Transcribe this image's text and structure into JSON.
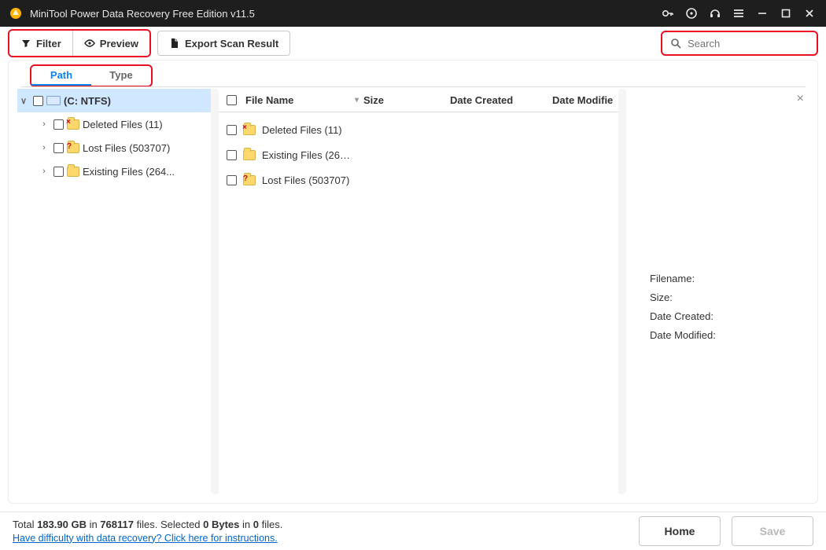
{
  "titlebar": {
    "title": "MiniTool Power Data Recovery Free Edition v11.5"
  },
  "toolbar": {
    "filter_label": "Filter",
    "preview_label": "Preview",
    "export_label": "Export Scan Result",
    "search_placeholder": "Search"
  },
  "tabs": {
    "path": "Path",
    "type": "Type"
  },
  "tree": {
    "root_label": "(C: NTFS)",
    "children": [
      {
        "label": "Deleted Files (11)",
        "icon": "redx"
      },
      {
        "label": "Lost Files (503707)",
        "icon": "q"
      },
      {
        "label": "Existing Files (264...",
        "icon": ""
      }
    ]
  },
  "list": {
    "headers": {
      "name": "File Name",
      "size": "Size",
      "created": "Date Created",
      "modified": "Date Modifie"
    },
    "rows": [
      {
        "name": "Deleted Files (11)",
        "icon": "redx"
      },
      {
        "name": "Existing Files (26…",
        "icon": ""
      },
      {
        "name": "Lost Files (503707)",
        "icon": "q"
      }
    ]
  },
  "detail": {
    "filename_label": "Filename:",
    "size_label": "Size:",
    "created_label": "Date Created:",
    "modified_label": "Date Modified:"
  },
  "footer": {
    "total_prefix": "Total ",
    "total_size": "183.90 GB",
    "in1": " in ",
    "total_files": "768117",
    "files_suffix": " files.  ",
    "selected_prefix": "Selected ",
    "selected_size": "0 Bytes",
    "in2": " in ",
    "selected_files": "0",
    "files_suffix2": " files.",
    "help_link": "Have difficulty with data recovery? Click here for instructions.",
    "home_label": "Home",
    "save_label": "Save"
  }
}
